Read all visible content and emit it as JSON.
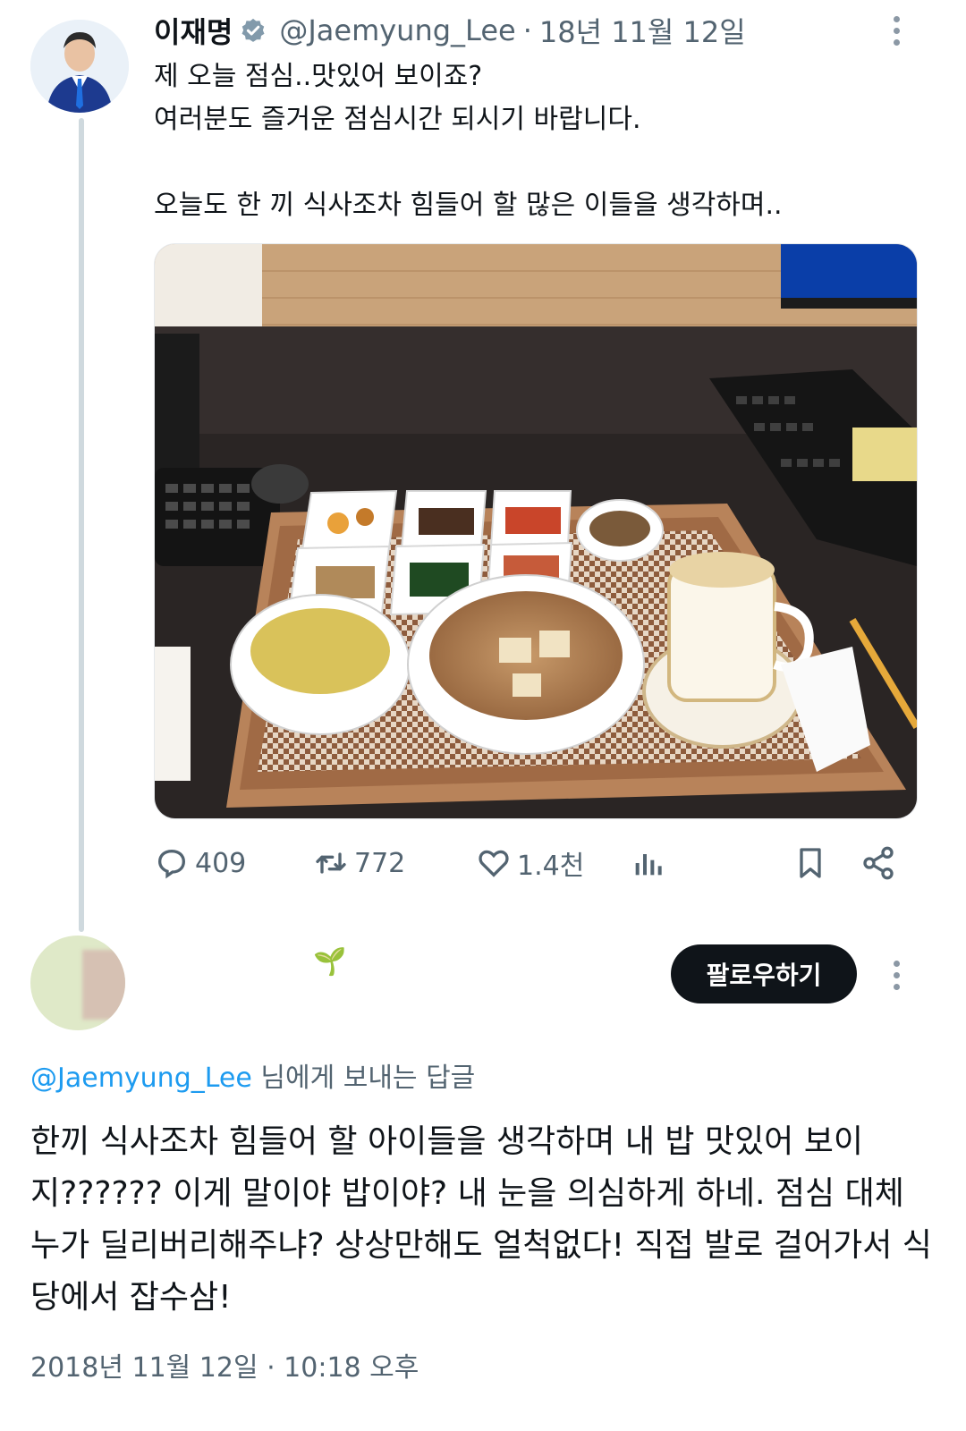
{
  "tweet": {
    "author_name": "이재명",
    "author_handle": "@Jaemyung_Lee",
    "separator": "·",
    "date": "18년 11월 12일",
    "lines": [
      "제 오늘 점심..맛있어 보이죠?",
      "여러분도 즐거운 점심시간 되시기 바랍니다.",
      "",
      "오늘도 한 끼 식사조차 힘들어 할 많은 이들을 생각하며.."
    ],
    "image_icon": "lunch-tray-photo",
    "stats": {
      "replies": "409",
      "retweets": "772",
      "likes": "1.4천"
    },
    "icons": {
      "reply": "speech-bubble-icon",
      "retweet": "retweet-icon",
      "like": "heart-icon",
      "views": "bar-chart-icon",
      "bookmark": "bookmark-icon",
      "share": "share-icon"
    },
    "verified_icon": "verified-badge-icon",
    "colors": {
      "text": "#0f1419",
      "secondary": "#536471",
      "link": "#1d9bf0",
      "button": "#0f1419",
      "thread_line": "#cfd9de"
    }
  },
  "reply": {
    "sprout_icon": "🌱",
    "follow_label": "팔로우하기",
    "reply_mention": "@Jaemyung_Lee",
    "reply_suffix": "님에게 보내는 답글",
    "text": "한끼 식사조차 힘들어 할 아이들을 생각하며 내 밥 맛있어 보이지?????? 이게 말이야 밥이야? 내 눈을 의심하게 하네. 점심 대체 누가 딜리버리해주냐? 상상만해도 얼척없다! 직접 발로 걸어가서 식당에서 잡수삼!",
    "timestamp": "2018년 11월 12일 · 10:18 오후"
  }
}
